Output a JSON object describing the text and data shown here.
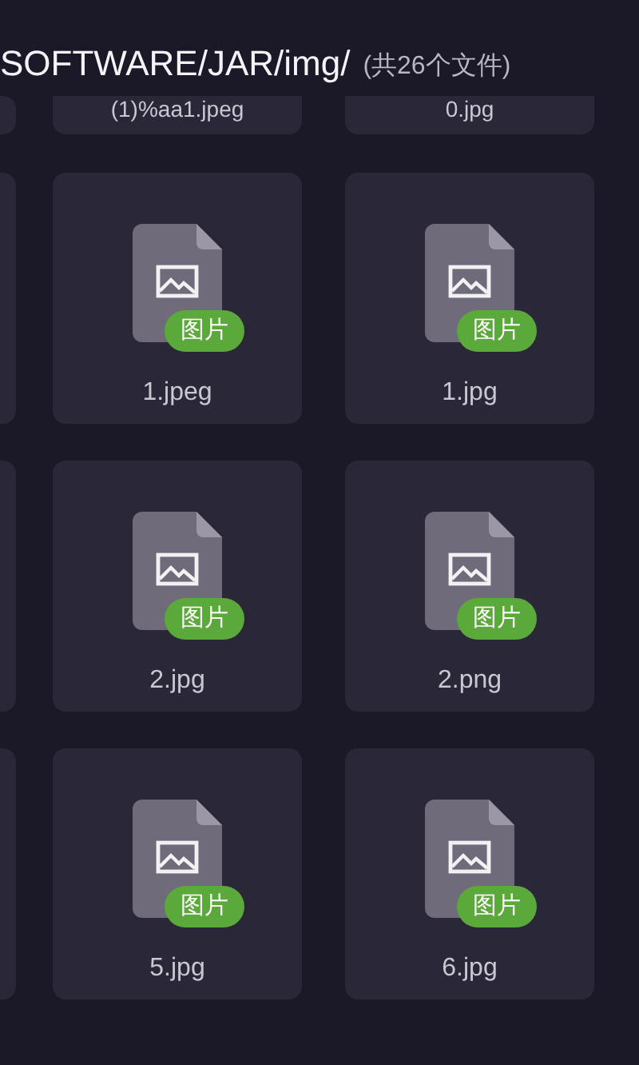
{
  "header": {
    "path": "SOFTWARE/JAR/img/",
    "count": "(共26个文件)"
  },
  "previous_row": [
    {
      "name": "(1)%aa1.jpeg"
    },
    {
      "name": "0.jpg"
    }
  ],
  "files": [
    {
      "name": "1.jpeg",
      "badge": "图片"
    },
    {
      "name": "1.jpg",
      "badge": "图片"
    },
    {
      "name": "2.jpg",
      "badge": "图片"
    },
    {
      "name": "2.png",
      "badge": "图片"
    },
    {
      "name": "5.jpg",
      "badge": "图片"
    },
    {
      "name": "6.jpg",
      "badge": "图片"
    }
  ]
}
